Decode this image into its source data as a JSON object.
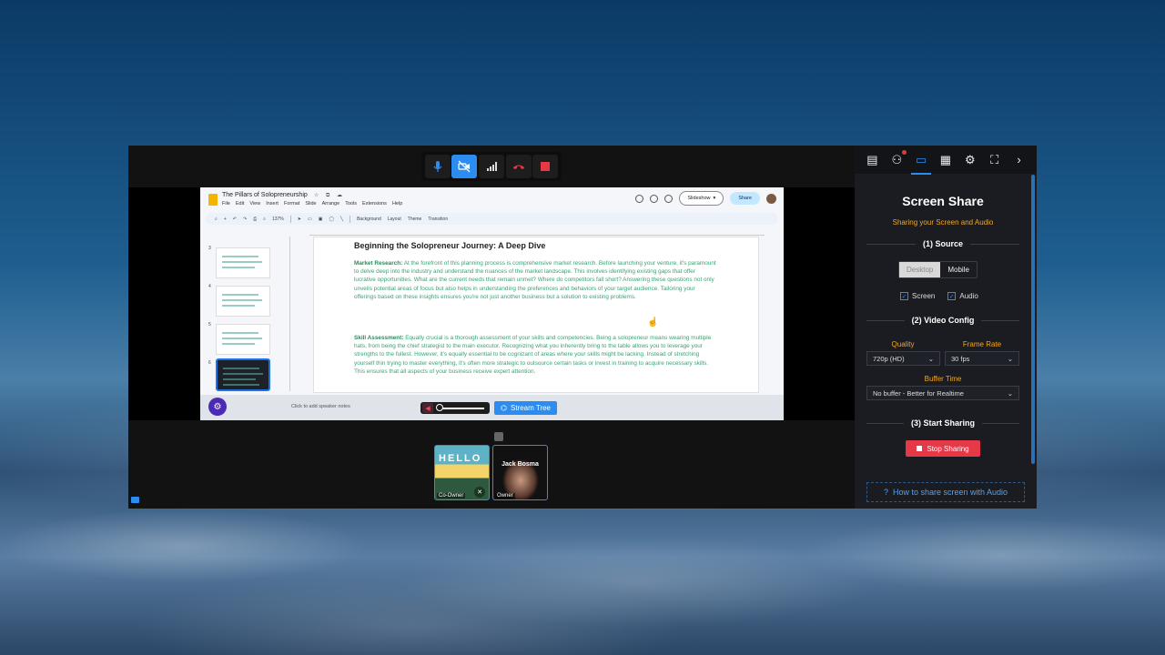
{
  "meeting_controls": {
    "icons": [
      "mic-icon",
      "camera-off-icon",
      "signal-icon",
      "hangup-icon",
      "stop-record-icon"
    ]
  },
  "slides_doc": {
    "title": "The Pillars of Solopreneurship",
    "menu": [
      "File",
      "Edit",
      "View",
      "Insert",
      "Format",
      "Slide",
      "Arrange",
      "Tools",
      "Extensions",
      "Help"
    ],
    "slideshow_label": "Slideshow",
    "share_label": "Share",
    "zoom": "137%",
    "toolbar_items": [
      "Background",
      "Layout",
      "Theme",
      "Transition"
    ],
    "thumb_numbers": [
      "3",
      "4",
      "5",
      "6"
    ],
    "slide_title": "Beginning the Solopreneur Journey: A Deep Dive",
    "para1_head": "Market Research:",
    "para1_body": " At the forefront of this planning process is comprehensive market research. Before launching your venture, it's paramount to delve deep into the industry and understand the nuances of the market landscape. This involves identifying existing gaps that offer lucrative opportunities. What are the current needs that remain unmet? Where do competitors fall short? Answering these questions not only unveils potential areas of focus but also helps in understanding the preferences and behaviors of your target audience. Tailoring your offerings based on these insights ensures you're not just another business but a solution to existing problems.",
    "para2_head": "Skill Assessment:",
    "para2_body": " Equally crucial is a thorough assessment of your skills and competencies. Being a solopreneur means wearing multiple hats, from being the chief strategist to the main executor. Recognizing what you inherently bring to the table allows you to leverage your strengths to the fullest. However, it's equally essential to be cognizant of areas where your skills might be lacking. Instead of stretching yourself thin trying to master everything, it's often more strategic to outsource certain tasks or invest in training to acquire necessary skills. This ensures that all aspects of your business receive expert attention.",
    "speaker_notes": "Click to add speaker notes"
  },
  "share_controls": {
    "stream_tree_label": "Stream Tree"
  },
  "participants": [
    {
      "label": "Co-Owner",
      "overlay": "HELLO"
    },
    {
      "name": "Jack Bosma",
      "label": "Owner"
    }
  ],
  "panel": {
    "tabs": [
      "chat-icon",
      "participants-icon",
      "screen-share-icon",
      "grid-icon",
      "settings-icon",
      "fullscreen-icon",
      "chevron-right-icon"
    ],
    "title": "Screen Share",
    "subtitle": "Sharing your Screen and Audio",
    "section1": "(1) Source",
    "source_options": [
      "Desktop",
      "Mobile"
    ],
    "source_selected": "Desktop",
    "check_screen": "Screen",
    "check_audio": "Audio",
    "section2": "(2) Video Config",
    "quality_label": "Quality",
    "quality_value": "720p (HD)",
    "framerate_label": "Frame Rate",
    "framerate_value": "30 fps",
    "buffer_label": "Buffer Time",
    "buffer_value": "No buffer - Better for Realtime",
    "section3": "(3) Start Sharing",
    "stop_label": "Stop Sharing",
    "help_link": "How to share screen with Audio"
  },
  "colors": {
    "accent": "#2d8cf0",
    "warning_label": "#f5a623",
    "stop": "#e53948",
    "slide_text": "#3aa373"
  }
}
